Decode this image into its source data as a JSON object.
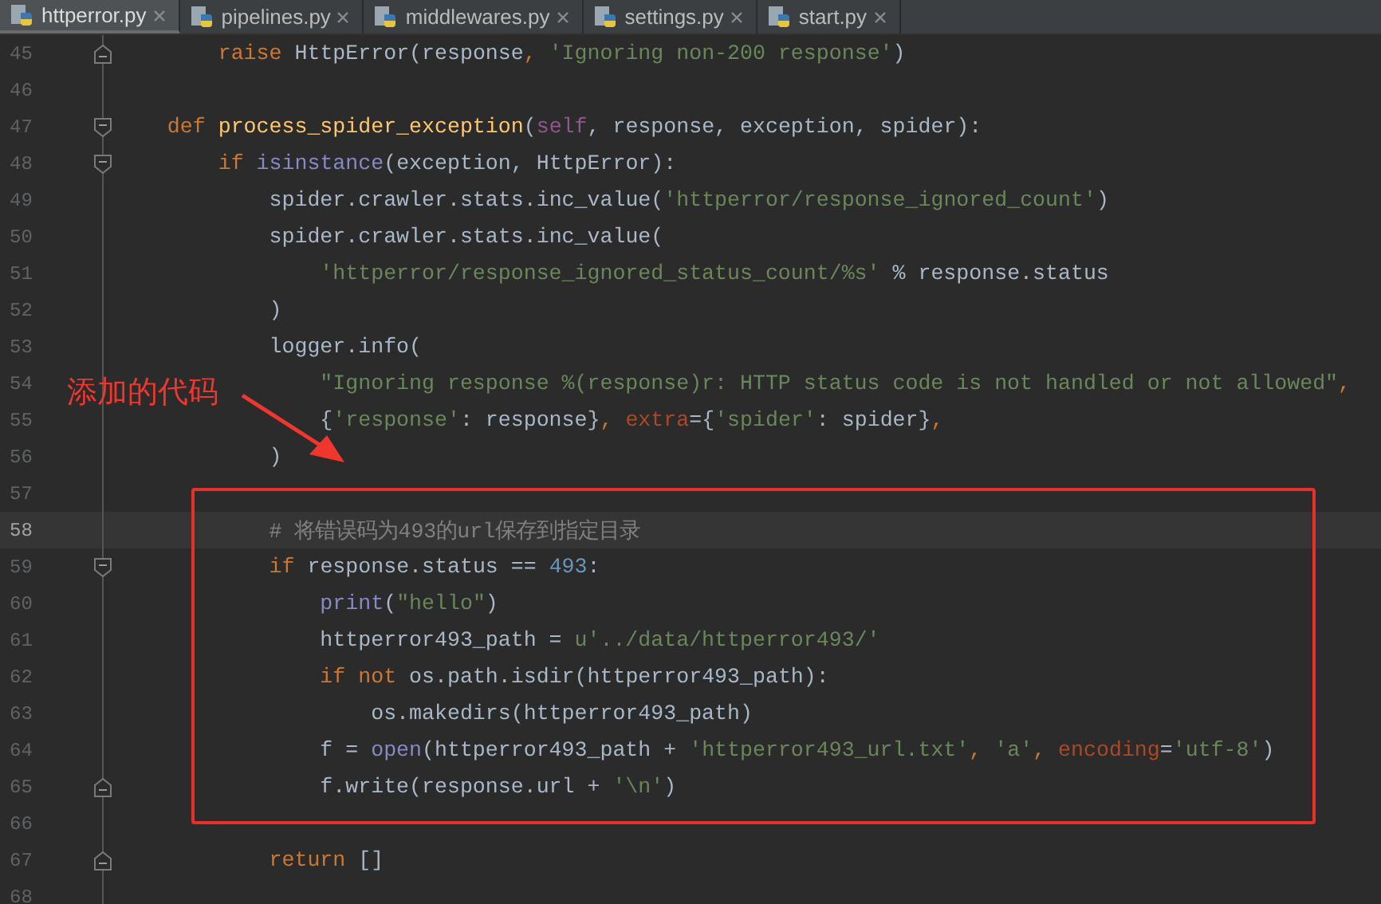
{
  "tabs": [
    {
      "label": "httperror.py",
      "selected": true
    },
    {
      "label": "pipelines.py",
      "selected": false
    },
    {
      "label": "middlewares.py",
      "selected": false
    },
    {
      "label": "settings.py",
      "selected": false
    },
    {
      "label": "start.py",
      "selected": false
    }
  ],
  "lines": [
    {
      "number": "45",
      "block_start": false,
      "block_end": true,
      "current": false,
      "tokens": [
        {
          "kind": "keyword",
          "text": "        raise"
        },
        {
          "kind": "plain",
          "text": " HttpError(response"
        },
        {
          "kind": "keyword",
          "text": ", "
        },
        {
          "kind": "string",
          "text": "'Ignoring non-200 response'"
        },
        {
          "kind": "plain",
          "text": ")"
        }
      ]
    },
    {
      "number": "46",
      "block_start": false,
      "block_end": false,
      "current": false
    },
    {
      "number": "47",
      "block_start": true,
      "block_end": false,
      "current": false,
      "tokens": [
        {
          "kind": "keyword",
          "text": "    def "
        },
        {
          "kind": "function",
          "text": "process_spider_exception"
        },
        {
          "kind": "plain",
          "text": "("
        },
        {
          "kind": "self",
          "text": "self"
        },
        {
          "kind": "plain",
          "text": ", response, exception, spider):"
        }
      ]
    },
    {
      "number": "48",
      "block_start": true,
      "block_end": false,
      "current": false,
      "tokens": [
        {
          "kind": "keyword",
          "text": "        if "
        },
        {
          "kind": "builtin",
          "text": "isinstance"
        },
        {
          "kind": "plain",
          "text": "(exception, HttpError):"
        }
      ]
    },
    {
      "number": "49",
      "block_start": false,
      "block_end": false,
      "current": false,
      "tokens": [
        {
          "kind": "plain",
          "text": "            spider.crawler.stats.inc_value("
        },
        {
          "kind": "string",
          "text": "'httperror/response_ignored_count'"
        },
        {
          "kind": "plain",
          "text": ")"
        }
      ]
    },
    {
      "number": "50",
      "block_start": false,
      "block_end": false,
      "current": false,
      "tokens": [
        {
          "kind": "plain",
          "text": "            spider.crawler.stats.inc_value("
        }
      ]
    },
    {
      "number": "51",
      "block_start": false,
      "block_end": false,
      "current": false,
      "tokens": [
        {
          "kind": "string",
          "text": "                'httperror/response_ignored_status_count/%s'"
        },
        {
          "kind": "plain",
          "text": " % response.status"
        }
      ]
    },
    {
      "number": "52",
      "block_start": false,
      "block_end": false,
      "current": false,
      "tokens": [
        {
          "kind": "plain",
          "text": "            )"
        }
      ]
    },
    {
      "number": "53",
      "block_start": false,
      "block_end": false,
      "current": false,
      "tokens": [
        {
          "kind": "plain",
          "text": "            logger.info("
        }
      ]
    },
    {
      "number": "54",
      "block_start": false,
      "block_end": false,
      "current": false,
      "tokens": [
        {
          "kind": "string",
          "text": "                \"Ignoring response %(response)r: HTTP status code is not handled or not allowed\""
        },
        {
          "kind": "keyword",
          "text": ","
        }
      ]
    },
    {
      "number": "55",
      "block_start": false,
      "block_end": false,
      "current": false,
      "tokens": [
        {
          "kind": "plain",
          "text": "                {"
        },
        {
          "kind": "string",
          "text": "'response'"
        },
        {
          "kind": "plain",
          "text": ": response}"
        },
        {
          "kind": "keyword",
          "text": ", "
        },
        {
          "kind": "kwarg",
          "text": "extra"
        },
        {
          "kind": "plain",
          "text": "={"
        },
        {
          "kind": "string",
          "text": "'spider'"
        },
        {
          "kind": "plain",
          "text": ": spider}"
        },
        {
          "kind": "keyword",
          "text": ","
        }
      ]
    },
    {
      "number": "56",
      "block_start": false,
      "block_end": false,
      "current": false,
      "tokens": [
        {
          "kind": "plain",
          "text": "            )"
        }
      ]
    },
    {
      "number": "57",
      "block_start": false,
      "block_end": false,
      "current": false
    },
    {
      "number": "58",
      "block_start": false,
      "block_end": false,
      "current": true,
      "tokens": [
        {
          "kind": "comment",
          "text": "            # 将错误码为493的url保存到指定目录"
        }
      ]
    },
    {
      "number": "59",
      "block_start": true,
      "block_end": false,
      "current": false,
      "tokens": [
        {
          "kind": "keyword",
          "text": "            if"
        },
        {
          "kind": "plain",
          "text": " response.status == "
        },
        {
          "kind": "number",
          "text": "493"
        },
        {
          "kind": "plain",
          "text": ":"
        }
      ]
    },
    {
      "number": "60",
      "block_start": false,
      "block_end": false,
      "current": false,
      "tokens": [
        {
          "kind": "builtin",
          "text": "                print"
        },
        {
          "kind": "plain",
          "text": "("
        },
        {
          "kind": "string",
          "text": "\"hello\""
        },
        {
          "kind": "plain",
          "text": ")"
        }
      ]
    },
    {
      "number": "61",
      "block_start": false,
      "block_end": false,
      "current": false,
      "tokens": [
        {
          "kind": "plain",
          "text": "                httperror493_path = "
        },
        {
          "kind": "string",
          "text": "u'../data/httperror493/'"
        }
      ]
    },
    {
      "number": "62",
      "block_start": false,
      "block_end": false,
      "current": false,
      "tokens": [
        {
          "kind": "keyword",
          "text": "                if not"
        },
        {
          "kind": "plain",
          "text": " os.path.isdir(httperror493_path):"
        }
      ]
    },
    {
      "number": "63",
      "block_start": false,
      "block_end": false,
      "current": false,
      "tokens": [
        {
          "kind": "plain",
          "text": "                    os.makedirs(httperror493_path)"
        }
      ]
    },
    {
      "number": "64",
      "block_start": false,
      "block_end": false,
      "current": false,
      "tokens": [
        {
          "kind": "plain",
          "text": "                f = "
        },
        {
          "kind": "builtin",
          "text": "open"
        },
        {
          "kind": "plain",
          "text": "(httperror493_path + "
        },
        {
          "kind": "string",
          "text": "'httperror493_url.txt'"
        },
        {
          "kind": "keyword",
          "text": ", "
        },
        {
          "kind": "string",
          "text": "'a'"
        },
        {
          "kind": "keyword",
          "text": ", "
        },
        {
          "kind": "kwarg",
          "text": "encoding"
        },
        {
          "kind": "plain",
          "text": "="
        },
        {
          "kind": "string",
          "text": "'utf-8'"
        },
        {
          "kind": "plain",
          "text": ")"
        }
      ]
    },
    {
      "number": "65",
      "block_start": false,
      "block_end": true,
      "current": false,
      "tokens": [
        {
          "kind": "plain",
          "text": "                f.write(response.url + "
        },
        {
          "kind": "string",
          "text": "'\\n'"
        },
        {
          "kind": "plain",
          "text": ")"
        }
      ]
    },
    {
      "number": "66",
      "block_start": false,
      "block_end": false,
      "current": false
    },
    {
      "number": "67",
      "block_start": false,
      "block_end": true,
      "current": false,
      "tokens": [
        {
          "kind": "keyword",
          "text": "            return"
        },
        {
          "kind": "plain",
          "text": " []"
        }
      ]
    },
    {
      "number": "68",
      "block_start": false,
      "block_end": false,
      "current": false
    }
  ],
  "annotation": {
    "label": "添加的代码"
  }
}
